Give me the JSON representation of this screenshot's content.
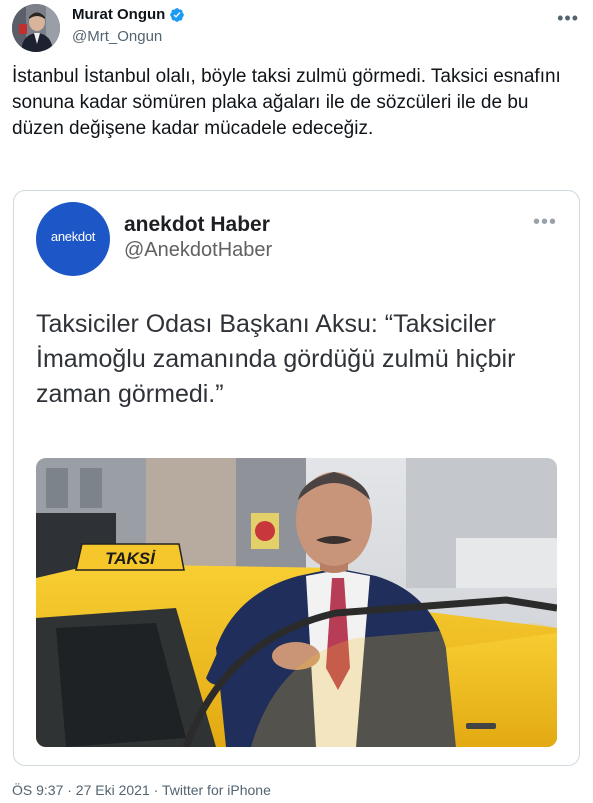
{
  "tweet": {
    "author_name": "Murat Ongun",
    "author_handle": "@Mrt_Ongun",
    "more_icon": "•••",
    "text": "İstanbul İstanbul olalı, böyle taksi zulmü görmedi. Taksici esnafını sonuna kadar sömüren plaka ağaları ile de sözcüleri ile de bu düzen değişene kadar mücadele edeceğiz.",
    "verified_color": "#1d9bf0"
  },
  "quote": {
    "logo_text": "anekdot",
    "author_name": "anekdot Haber",
    "author_handle": "@AnekdotHaber",
    "more_icon": "•••",
    "headline": "Taksiciler Odası Başkanı Aksu: “Taksiciler İmamoğlu zamanında gördüğü zulmü hiçbir zaman görmedi.”",
    "taxi_sign": "TAKSİ",
    "logo_color": "#1d57c7"
  },
  "footer": {
    "meta": "ÖS 9:37 · 27 Eki 2021 · Twitter for iPhone"
  }
}
